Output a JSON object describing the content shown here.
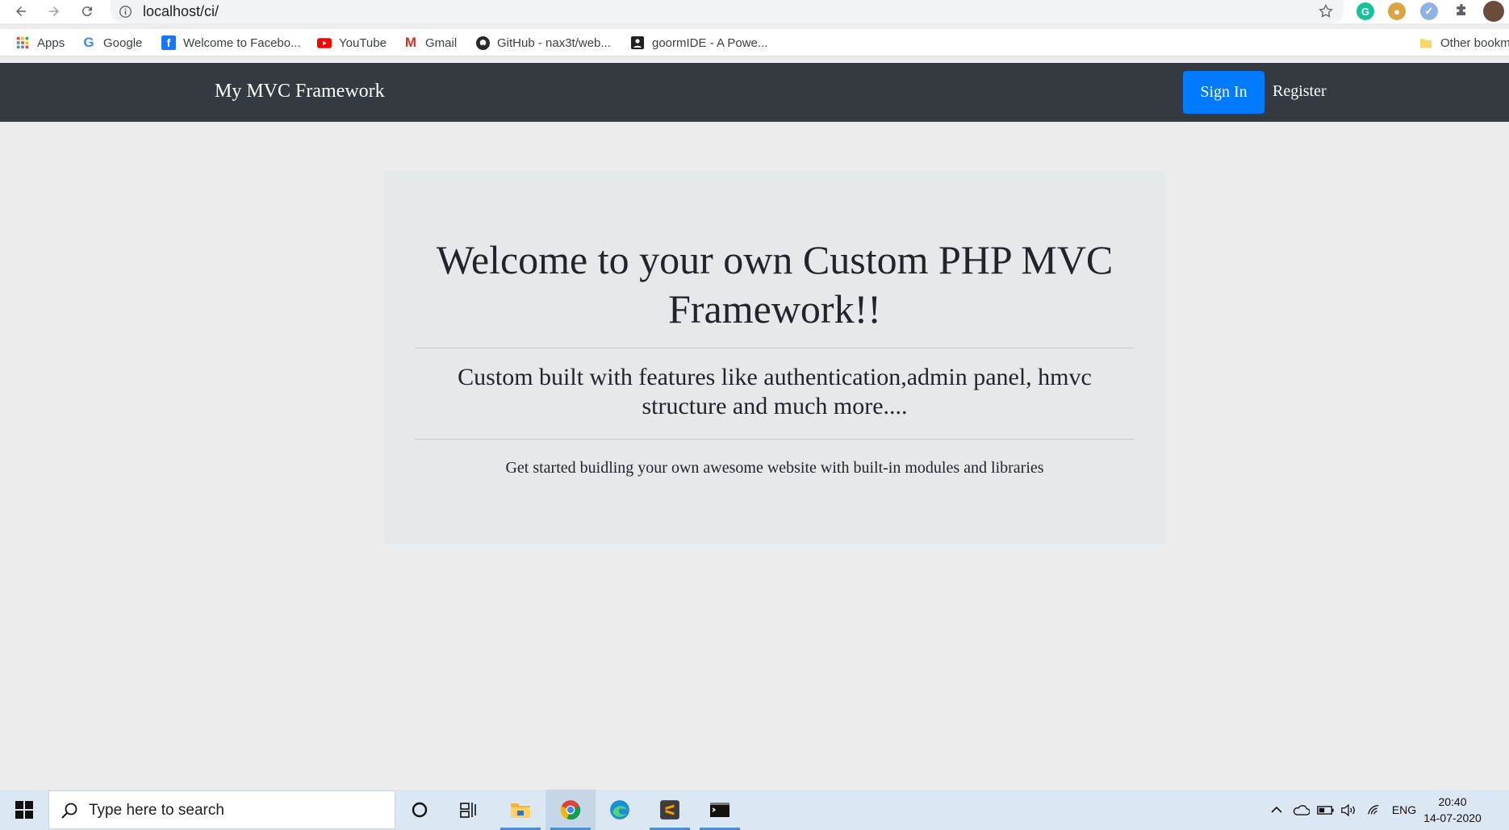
{
  "browser": {
    "url": "localhost/ci/",
    "bookmarks": [
      {
        "label": "Apps",
        "icon": "apps-grid-icon"
      },
      {
        "label": "Google",
        "icon": "google-icon"
      },
      {
        "label": "Welcome to Facebo...",
        "icon": "facebook-icon"
      },
      {
        "label": "YouTube",
        "icon": "youtube-icon"
      },
      {
        "label": "Gmail",
        "icon": "gmail-icon"
      },
      {
        "label": "GitHub - nax3t/web...",
        "icon": "github-icon"
      },
      {
        "label": "goormIDE - A Powe...",
        "icon": "goormide-icon"
      }
    ],
    "other_bookmarks": "Other bookm"
  },
  "navbar": {
    "brand": "My MVC Framework",
    "signin_label": "Sign In",
    "register_label": "Register"
  },
  "jumbotron": {
    "heading": "Welcome to your own Custom PHP MVC Framework!!",
    "lead": "Custom built with features like authentication,admin panel, hmvc structure and much more....",
    "sub": "Get started buidling your own awesome website with built-in modules and libraries"
  },
  "taskbar": {
    "search_placeholder": "Type here to search",
    "language": "ENG",
    "time": "20:40",
    "date": "14-07-2020"
  },
  "colors": {
    "navbar_bg": "#343a40",
    "primary": "#007bff",
    "page_bg": "#ececec",
    "jumbotron_bg": "#e6e9ec"
  }
}
